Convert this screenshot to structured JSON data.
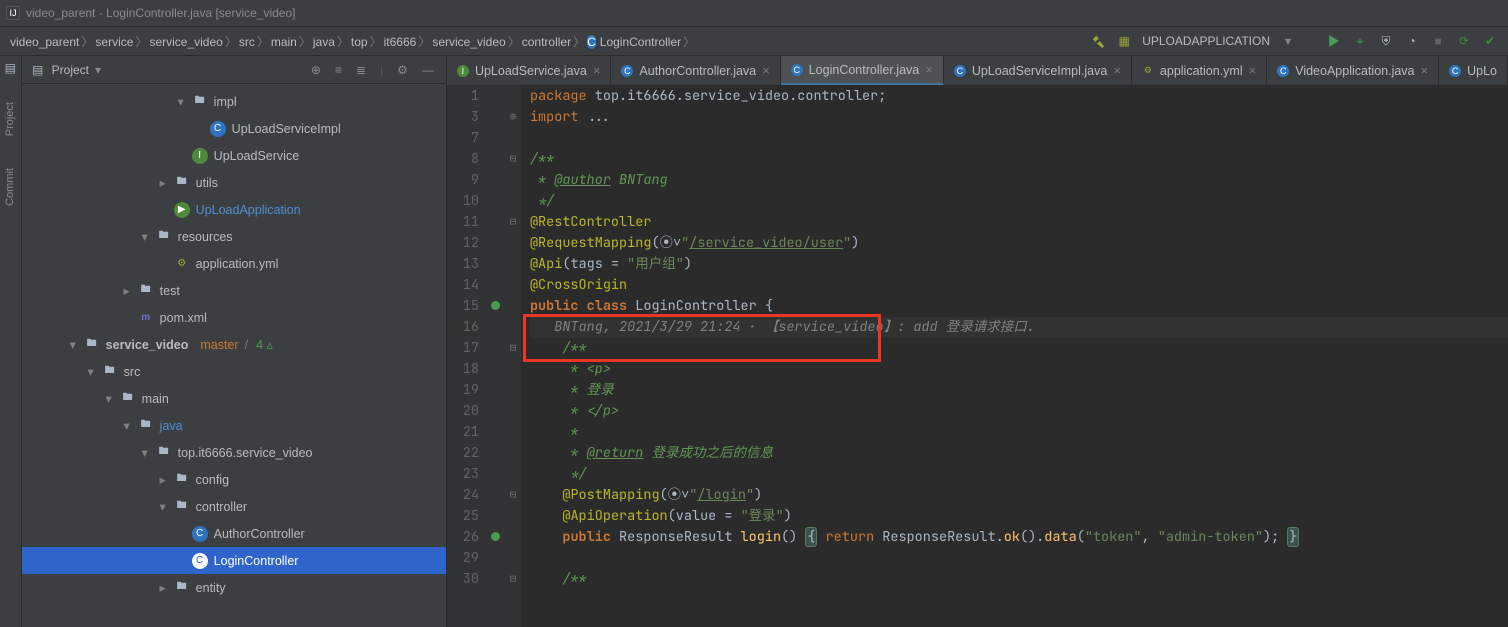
{
  "window_title": "video_parent - LoginController.java [service_video]",
  "breadcrumbs": [
    "video_parent",
    "service",
    "service_video",
    "src",
    "main",
    "java",
    "top",
    "it6666",
    "service_video",
    "controller",
    "LoginController"
  ],
  "run_config": "UPLOADAPPLICATION",
  "project_panel": {
    "label": "Project"
  },
  "side_tools": {
    "project": "Project",
    "commit": "Commit"
  },
  "tree": {
    "impl": "impl",
    "uploadServiceImpl": "UpLoadServiceImpl",
    "uploadService": "UpLoadService",
    "utils": "utils",
    "uploadApplication": "UpLoadApplication",
    "resources": "resources",
    "applicationYml": "application.yml",
    "test": "test",
    "pom": "pom.xml",
    "service_video": "service_video",
    "branch": "master",
    "mods_sep": "/",
    "mods": "4 ▵",
    "src": "src",
    "main": "main",
    "java": "java",
    "package": "top.it6666.service_video",
    "config": "config",
    "controller": "controller",
    "authorController": "AuthorController",
    "loginController": "LoginController",
    "entity": "entity"
  },
  "tabs": [
    {
      "label": "UpLoadService.java",
      "icon": "int"
    },
    {
      "label": "AuthorController.java",
      "icon": "class"
    },
    {
      "label": "LoginController.java",
      "icon": "class",
      "active": true
    },
    {
      "label": "UpLoadServiceImpl.java",
      "icon": "class"
    },
    {
      "label": "application.yml",
      "icon": "yml"
    },
    {
      "label": "VideoApplication.java",
      "icon": "class"
    },
    {
      "label": "UpLo",
      "icon": "class",
      "cut": true
    }
  ],
  "code": {
    "first_ln": 1,
    "lines": [
      {
        "n": 1,
        "fold": "",
        "seg": [
          [
            "kw",
            "package "
          ],
          [
            "id",
            "top.it6666.service_video.controller"
          ],
          [
            "punct",
            ";"
          ]
        ]
      },
      {
        "n": 3,
        "fold": "⊕",
        "seg": [
          [
            "kw",
            "import "
          ],
          [
            "id",
            "..."
          ]
        ]
      },
      {
        "n": 7,
        "fold": "",
        "seg": []
      },
      {
        "n": 8,
        "fold": "⊟",
        "seg": [
          [
            "comd",
            "/**"
          ]
        ]
      },
      {
        "n": 9,
        "fold": "",
        "seg": [
          [
            "comd",
            " * "
          ],
          [
            "comdu",
            "@author"
          ],
          [
            "comd",
            " BNTang"
          ]
        ]
      },
      {
        "n": 10,
        "fold": "",
        "seg": [
          [
            "comd",
            " */"
          ]
        ]
      },
      {
        "n": 11,
        "fold": "⊟",
        "seg": [
          [
            "ann",
            "@RestController"
          ]
        ]
      },
      {
        "n": 12,
        "fold": "",
        "seg": [
          [
            "ann",
            "@RequestMapping"
          ],
          [
            "punct",
            "(⦿˅"
          ],
          [
            "str",
            "\""
          ],
          [
            "strlink",
            "/service_video/user"
          ],
          [
            "str",
            "\""
          ],
          [
            "punct",
            ")"
          ]
        ]
      },
      {
        "n": 13,
        "fold": "",
        "seg": [
          [
            "ann",
            "@Api"
          ],
          [
            "punct",
            "("
          ],
          [
            "id",
            "tags = "
          ],
          [
            "str",
            "\"用户组\""
          ],
          [
            "punct",
            ")"
          ]
        ]
      },
      {
        "n": 14,
        "fold": "",
        "seg": [
          [
            "ann",
            "@CrossOrigin"
          ]
        ]
      },
      {
        "n": 15,
        "fold": "",
        "mark": "m",
        "seg": [
          [
            "kw-bold",
            "public class "
          ],
          [
            "id",
            "LoginController "
          ],
          [
            "punct",
            "{"
          ]
        ]
      },
      {
        "n": 16,
        "fold": "",
        "caret": true,
        "seg": [
          [
            "com",
            "   BNTang, 2021/3/29 21:24 · 【service_video】: add 登录请求接口."
          ]
        ]
      },
      {
        "n": 17,
        "fold": "⊟",
        "seg": [
          [
            "comd",
            "    /**"
          ]
        ]
      },
      {
        "n": 18,
        "fold": "",
        "seg": [
          [
            "comd",
            "     * <p>"
          ]
        ]
      },
      {
        "n": 19,
        "fold": "",
        "seg": [
          [
            "comd",
            "     * 登录"
          ]
        ]
      },
      {
        "n": 20,
        "fold": "",
        "seg": [
          [
            "comd",
            "     * </p>"
          ]
        ]
      },
      {
        "n": 21,
        "fold": "",
        "seg": [
          [
            "comd",
            "     *"
          ]
        ]
      },
      {
        "n": 22,
        "fold": "",
        "seg": [
          [
            "comd",
            "     * "
          ],
          [
            "comdu",
            "@return"
          ],
          [
            "comd",
            " 登录成功之后的信息"
          ]
        ]
      },
      {
        "n": 23,
        "fold": "",
        "seg": [
          [
            "comd",
            "     */"
          ]
        ]
      },
      {
        "n": 24,
        "fold": "⊟",
        "seg": [
          [
            "id",
            "    "
          ],
          [
            "ann",
            "@PostMapping"
          ],
          [
            "punct",
            "(⦿˅"
          ],
          [
            "str",
            "\""
          ],
          [
            "strlink",
            "/login"
          ],
          [
            "str",
            "\""
          ],
          [
            "punct",
            ")"
          ]
        ]
      },
      {
        "n": 25,
        "fold": "",
        "seg": [
          [
            "id",
            "    "
          ],
          [
            "ann",
            "@ApiOperation"
          ],
          [
            "punct",
            "("
          ],
          [
            "id",
            "value = "
          ],
          [
            "str",
            "\"登录\""
          ],
          [
            "punct",
            ")"
          ]
        ]
      },
      {
        "n": 26,
        "fold": "",
        "mark": "m",
        "seg": [
          [
            "id",
            "    "
          ],
          [
            "kw-bold",
            "public "
          ],
          [
            "id",
            "ResponseResult "
          ],
          [
            "fn",
            "login"
          ],
          [
            "punct",
            "() "
          ],
          [
            "brace",
            "{"
          ],
          [
            "punct",
            " "
          ],
          [
            "kw",
            "return "
          ],
          [
            "id",
            "ResponseResult."
          ],
          [
            "fn",
            "ok"
          ],
          [
            "punct",
            "()."
          ],
          [
            "fn",
            "data"
          ],
          [
            "punct",
            "("
          ],
          [
            "str",
            "\"token\""
          ],
          [
            "punct",
            ", "
          ],
          [
            "str",
            "\"admin-token\""
          ],
          [
            "punct",
            "); "
          ],
          [
            "brace",
            "}"
          ]
        ]
      },
      {
        "n": 29,
        "fold": "",
        "seg": []
      },
      {
        "n": 30,
        "fold": "⊟",
        "seg": [
          [
            "comd",
            "    /**"
          ]
        ]
      }
    ]
  }
}
